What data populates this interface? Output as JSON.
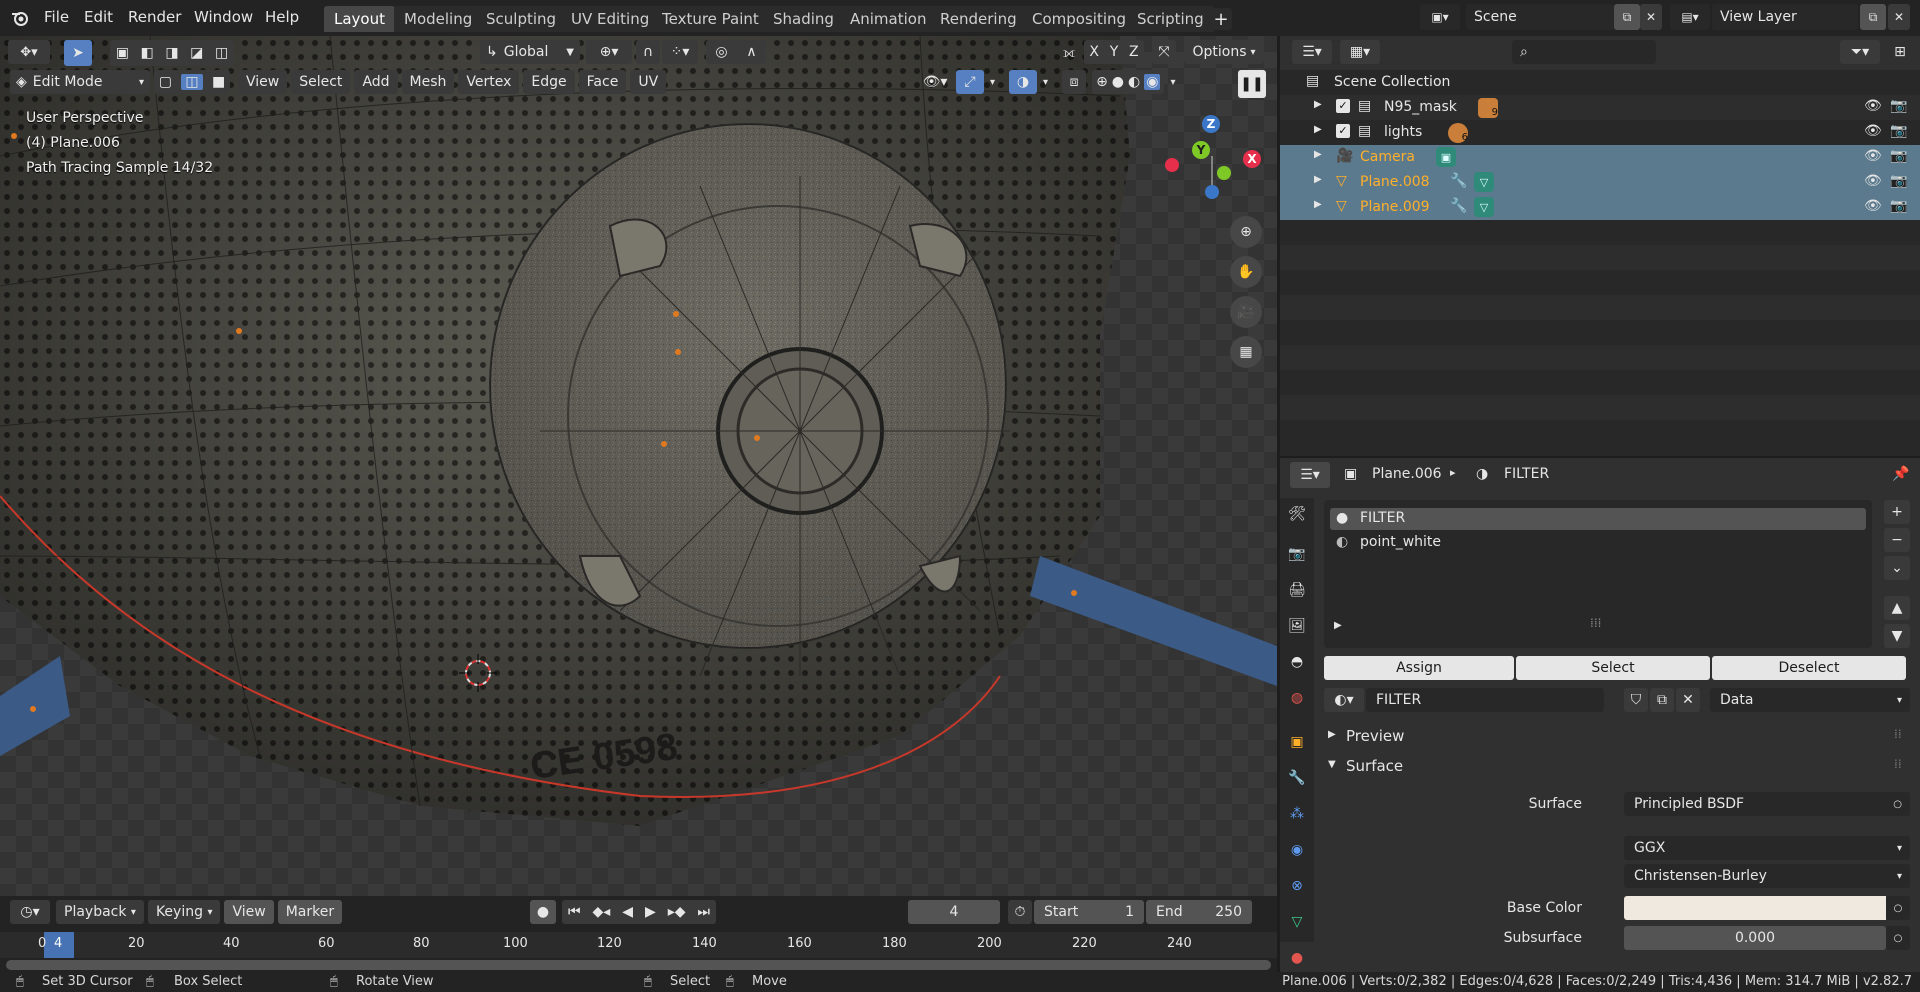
{
  "menu": [
    "File",
    "Edit",
    "Render",
    "Window",
    "Help"
  ],
  "workspaces": [
    "Layout",
    "Modeling",
    "Sculpting",
    "UV Editing",
    "Texture Paint",
    "Shading",
    "Animation",
    "Rendering",
    "Compositing",
    "Scripting"
  ],
  "scene": {
    "label": "Scene",
    "view_layer": "View Layer"
  },
  "toolbar": {
    "orientation": "Global",
    "options": "Options",
    "axes": [
      "X",
      "Y",
      "Z"
    ]
  },
  "vp_header": {
    "mode": "Edit Mode",
    "menus": [
      "View",
      "Select",
      "Add",
      "Mesh",
      "Vertex",
      "Edge",
      "Face",
      "UV"
    ]
  },
  "overlay": {
    "perspective": "User Perspective",
    "object": "(4) Plane.006",
    "sample": "Path Tracing Sample 14/32"
  },
  "gizmo": {
    "z": "Z",
    "y": "Y",
    "x": "X"
  },
  "mask_text": "CE 0598",
  "outliner": {
    "root": "Scene Collection",
    "items": [
      {
        "name": "N95_mask",
        "badge": "9",
        "selected": false,
        "orange": false
      },
      {
        "name": "lights",
        "badge": "6",
        "selected": false,
        "orange": false
      },
      {
        "name": "Camera",
        "badge": "",
        "selected": true,
        "orange": true
      },
      {
        "name": "Plane.008",
        "badge": "",
        "selected": true,
        "orange": true
      },
      {
        "name": "Plane.009",
        "badge": "",
        "selected": true,
        "orange": true
      }
    ]
  },
  "properties": {
    "breadcrumb_object": "Plane.006",
    "breadcrumb_material": "FILTER",
    "slots": [
      "FILTER",
      "point_white"
    ],
    "assign": "Assign",
    "select": "Select",
    "deselect": "Deselect",
    "material_name": "FILTER",
    "link": "Data",
    "panel_preview": "Preview",
    "panel_surface": "Surface",
    "surface_label": "Surface",
    "surface_value": "Principled BSDF",
    "distribution": "GGX",
    "sss_method": "Christensen-Burley",
    "base_color_label": "Base Color",
    "base_color": "#efe9df",
    "subsurface_label": "Subsurface",
    "subsurface_value": "0.000"
  },
  "timeline": {
    "menus": [
      "Playback",
      "Keying",
      "View",
      "Marker"
    ],
    "current_frame": "4",
    "start_label": "Start",
    "start": "1",
    "end_label": "End",
    "end": "250",
    "ruler": [
      "0",
      "20",
      "40",
      "60",
      "80",
      "100",
      "120",
      "140",
      "160",
      "180",
      "200",
      "220",
      "240"
    ],
    "ruler_current": "4"
  },
  "status": {
    "left": [
      "Set 3D Cursor",
      "Box Select",
      "Rotate View",
      "Select",
      "Move"
    ],
    "stats": "Plane.006 | Verts:0/2,382 | Edges:0/4,628 | Faces:0/2,249 | Tris:4,436 | Mem: 314.7 MiB | v2.82.7"
  }
}
